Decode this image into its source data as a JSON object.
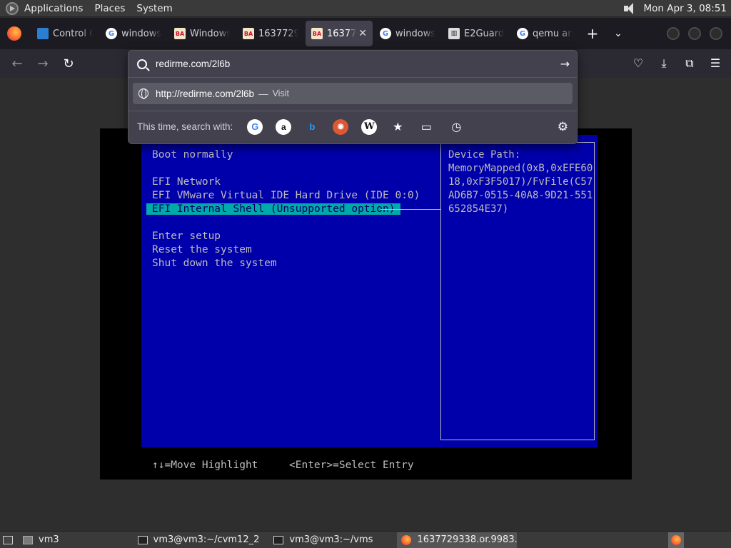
{
  "top_panel": {
    "menus": [
      "Applications",
      "Places",
      "System"
    ],
    "clock": "Mon Apr  3, 08:51"
  },
  "tabs": [
    {
      "label": "Control C",
      "icon": "monitor-icon",
      "active": false
    },
    {
      "label": "windows",
      "icon": "google-icon",
      "active": false
    },
    {
      "label": "Windows",
      "icon": "bugzilla-icon",
      "active": false
    },
    {
      "label": "1637729",
      "icon": "bugzilla-icon",
      "active": false
    },
    {
      "label": "16377",
      "icon": "bugzilla-icon",
      "active": true
    },
    {
      "label": "windows",
      "icon": "google-icon",
      "active": false
    },
    {
      "label": "E2Guard",
      "icon": "e2guardian-icon",
      "active": false
    },
    {
      "label": "qemu an",
      "icon": "google-icon",
      "active": false
    }
  ],
  "urlbar": {
    "value": "redirme.com/2l6b",
    "suggestion_url": "http://redirme.com/2l6b",
    "suggestion_separator": "—",
    "suggestion_action": "Visit",
    "search_with_label": "This time, search with:"
  },
  "efi": {
    "menu": {
      "boot_normally": "Boot normally",
      "efi_network": "EFI Network",
      "efi_hdd": "EFI VMware Virtual IDE Hard Drive (IDE 0:0)",
      "efi_shell": "EFI Internal Shell (Unsupported option)",
      "enter_setup": "Enter setup",
      "reset": "Reset the system",
      "shutdown": "Shut down the system"
    },
    "device_path": {
      "label": "Device Path:",
      "lines": [
        "MemoryMapped(0xB,0xEFE60",
        "18,0xF3F5017)/FvFile(C57",
        "AD6B7-0515-40A8-9D21-551",
        "652854E37)"
      ]
    },
    "footer": {
      "move": "↑↓=Move Highlight",
      "select": "<Enter>=Select Entry"
    }
  },
  "taskbar": {
    "items": [
      {
        "label": "vm3",
        "icon": "folder-icon"
      },
      {
        "label": "vm3@vm3:~/cvm12_2",
        "icon": "terminal-icon"
      },
      {
        "label": "vm3@vm3:~/vms",
        "icon": "terminal-icon"
      },
      {
        "label": "1637729338.or.9983...",
        "icon": "firefox-icon"
      }
    ]
  },
  "colors": {
    "efi_background": "#0000aa",
    "efi_highlight": "#00aaaa",
    "efi_text": "#bcbcbc",
    "firefox_toolbar": "#2b2a33"
  }
}
